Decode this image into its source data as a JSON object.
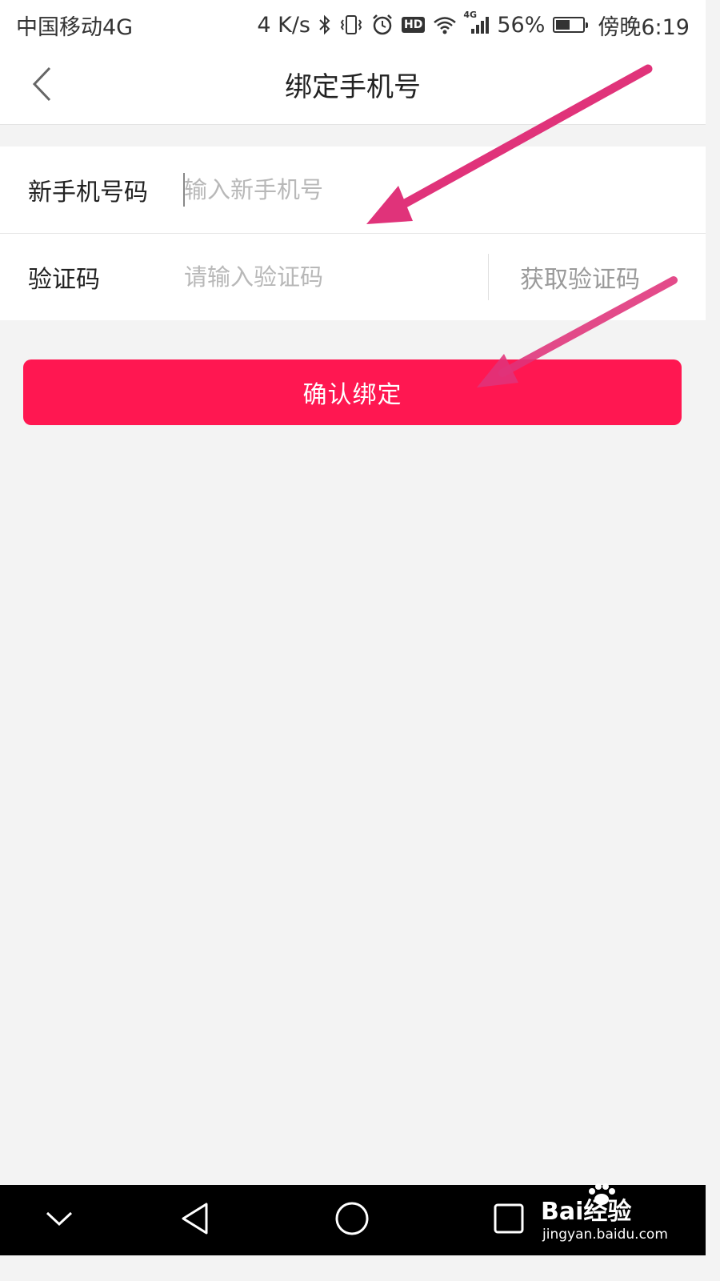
{
  "status_bar": {
    "carrier": "中国移动4G",
    "speed": "4 K/s",
    "network": "4G",
    "hd": "HD",
    "battery_percent_text": "56%",
    "battery_level": 0.56,
    "time": "傍晚6:19"
  },
  "header": {
    "title": "绑定手机号",
    "back_icon": "chevron-left-icon"
  },
  "form": {
    "phone": {
      "label": "新手机号码",
      "placeholder": "输入新手机号",
      "value": ""
    },
    "code": {
      "label": "验证码",
      "placeholder": "请输入验证码",
      "value": "",
      "get_code_label": "获取验证码"
    }
  },
  "confirm_button": {
    "label": "确认绑定"
  },
  "colors": {
    "accent": "#ff1751",
    "annotation_arrow": "#e0337a",
    "background": "#f3f3f3"
  },
  "watermark": {
    "brand": "Bai经验",
    "site": "jingyan.baidu.com"
  }
}
